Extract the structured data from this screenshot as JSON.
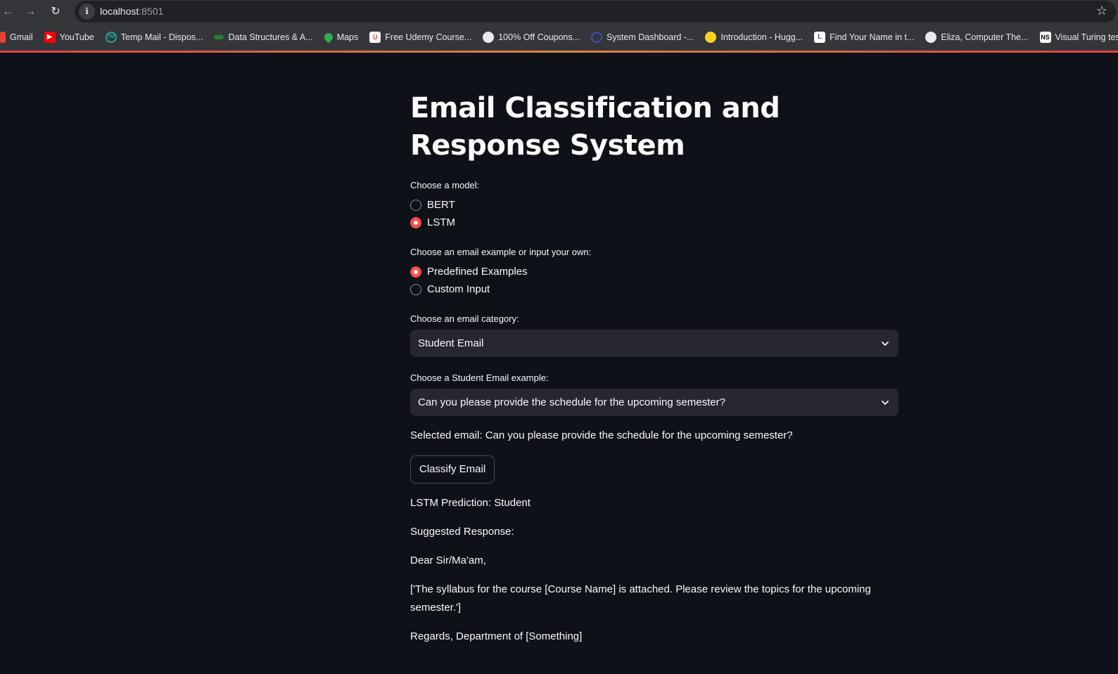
{
  "browser": {
    "url_host": "localhost",
    "url_port": ":8501",
    "bookmarks": [
      {
        "label": "Gmail",
        "icon": "gmail-icon"
      },
      {
        "label": "YouTube",
        "icon": "youtube-icon"
      },
      {
        "label": "Temp Mail - Dispos...",
        "icon": "tempmail-icon"
      },
      {
        "label": "Data Structures & A...",
        "icon": "data-structures-icon"
      },
      {
        "label": "Maps",
        "icon": "maps-icon"
      },
      {
        "label": "Free Udemy Course...",
        "icon": "udemy-icon"
      },
      {
        "label": "100% Off Coupons...",
        "icon": "globe-icon"
      },
      {
        "label": "System Dashboard -...",
        "icon": "system-dashboard-icon"
      },
      {
        "label": "Introduction - Hugg...",
        "icon": "huggingface-icon"
      },
      {
        "label": "Find Your Name in t...",
        "icon": "find-name-icon"
      },
      {
        "label": "Eliza, Computer The...",
        "icon": "globe-icon"
      },
      {
        "label": "Visual Turing test |...",
        "icon": "ns-icon"
      }
    ]
  },
  "app": {
    "title": "Email Classification and Response System",
    "model_label": "Choose a model:",
    "model_options": [
      "BERT",
      "LSTM"
    ],
    "model_selected": "LSTM",
    "source_label": "Choose an email example or input your own:",
    "source_options": [
      "Predefined Examples",
      "Custom Input"
    ],
    "source_selected": "Predefined Examples",
    "category_label": "Choose an email category:",
    "category_value": "Student Email",
    "example_label": "Choose a Student Email example:",
    "example_value": "Can you please provide the schedule for the upcoming semester?",
    "selected_email": "Selected email: Can you please provide the schedule for the upcoming semester?",
    "classify_button": "Classify Email",
    "prediction": "LSTM Prediction: Student",
    "suggested_label": "Suggested Response:",
    "greeting": "Dear Sir/Ma'am,",
    "response_body": "['The syllabus for the course [Course Name] is attached. Please review the topics for the upcoming semester.']",
    "signoff": "Regards, Department of [Something]"
  },
  "colors": {
    "background": "#0e1117",
    "accent": "#ff4b4b",
    "widget": "#262730"
  }
}
